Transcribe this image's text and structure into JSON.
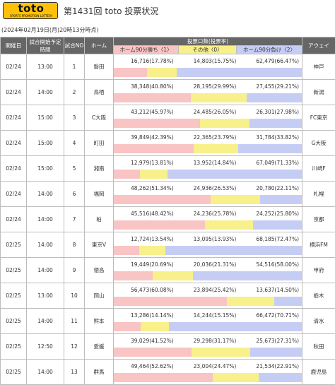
{
  "header": {
    "logo_text": "toto",
    "logo_sub": "SPORTS PROMOTION LOTTERY",
    "title": "第1431回 toto 投票状況"
  },
  "timestamp": "(2024年02月19日(月)20時13分時点)",
  "columns": {
    "date": "開催日",
    "kickoff": "試合開始予定時間",
    "match_no": "試合NO",
    "home": "ホーム",
    "votes": "投票口数(投票率)",
    "win": "ホーム90分勝ち〈1〉",
    "draw": "その他〈0〉",
    "lose": "ホーム90分負け〈2〉",
    "away": "アウェイ"
  },
  "colors": {
    "win": "#f8c4c4",
    "draw": "#f8f08a",
    "lose": "#c6cdf5",
    "header_bg": "#666666",
    "logo": "#ffc107"
  },
  "rows": [
    {
      "date": "02/24",
      "time": "13:00",
      "no": "1",
      "home": "磐田",
      "win_text": "16,716(17.78%)",
      "win": 17.78,
      "draw_text": "14,803(15.75%)",
      "draw": 15.75,
      "lose_text": "62,479(66.47%)",
      "lose": 66.47,
      "away": "神戸"
    },
    {
      "date": "02/24",
      "time": "14:00",
      "no": "2",
      "home": "鳥栖",
      "win_text": "38,348(40.80%)",
      "win": 40.8,
      "draw_text": "28,195(29.99%)",
      "draw": 29.99,
      "lose_text": "27,455(29.21%)",
      "lose": 29.21,
      "away": "新潟"
    },
    {
      "date": "02/24",
      "time": "15:00",
      "no": "3",
      "home": "C大阪",
      "win_text": "43,212(45.97%)",
      "win": 45.97,
      "draw_text": "24,485(26.05%)",
      "draw": 26.05,
      "lose_text": "26,301(27.98%)",
      "lose": 27.98,
      "away": "FC東京"
    },
    {
      "date": "02/24",
      "time": "15:00",
      "no": "4",
      "home": "町田",
      "win_text": "39,849(42.39%)",
      "win": 42.39,
      "draw_text": "22,365(23.79%)",
      "draw": 23.79,
      "lose_text": "31,784(33.82%)",
      "lose": 33.82,
      "away": "G大阪"
    },
    {
      "date": "02/24",
      "time": "15:00",
      "no": "5",
      "home": "湘南",
      "win_text": "12,979(13.81%)",
      "win": 13.81,
      "draw_text": "13,952(14.84%)",
      "draw": 14.84,
      "lose_text": "67,049(71.33%)",
      "lose": 71.33,
      "away": "川崎F"
    },
    {
      "date": "02/24",
      "time": "14:00",
      "no": "6",
      "home": "福岡",
      "win_text": "48,262(51.34%)",
      "win": 51.34,
      "draw_text": "24,936(26.53%)",
      "draw": 26.53,
      "lose_text": "20,780(22.11%)",
      "lose": 22.11,
      "away": "札幌"
    },
    {
      "date": "02/24",
      "time": "14:00",
      "no": "7",
      "home": "柏",
      "win_text": "45,516(48.42%)",
      "win": 48.42,
      "draw_text": "24,236(25.78%)",
      "draw": 25.78,
      "lose_text": "24,252(25.80%)",
      "lose": 25.8,
      "away": "京都"
    },
    {
      "date": "02/25",
      "time": "14:00",
      "no": "8",
      "home": "東京V",
      "win_text": "12,724(13.54%)",
      "win": 13.54,
      "draw_text": "13,095(13.93%)",
      "draw": 13.93,
      "lose_text": "68,185(72.47%)",
      "lose": 72.47,
      "away": "横浜FM"
    },
    {
      "date": "02/25",
      "time": "14:00",
      "no": "9",
      "home": "徳島",
      "win_text": "19,449(20.69%)",
      "win": 20.69,
      "draw_text": "20,036(21.31%)",
      "draw": 21.31,
      "lose_text": "54,516(58.00%)",
      "lose": 58.0,
      "away": "甲府"
    },
    {
      "date": "02/25",
      "time": "13:00",
      "no": "10",
      "home": "岡山",
      "win_text": "56,473(60.08%)",
      "win": 60.08,
      "draw_text": "23,894(25.42%)",
      "draw": 25.42,
      "lose_text": "13,637(14.50%)",
      "lose": 14.5,
      "away": "栃木"
    },
    {
      "date": "02/25",
      "time": "14:00",
      "no": "11",
      "home": "熊本",
      "win_text": "13,286(14.14%)",
      "win": 14.14,
      "draw_text": "14,244(15.15%)",
      "draw": 15.15,
      "lose_text": "66,472(70.71%)",
      "lose": 70.71,
      "away": "清水"
    },
    {
      "date": "02/25",
      "time": "12:50",
      "no": "12",
      "home": "愛媛",
      "win_text": "39,029(41.52%)",
      "win": 41.52,
      "draw_text": "29,298(31.17%)",
      "draw": 31.17,
      "lose_text": "25,673(27.31%)",
      "lose": 27.31,
      "away": "秋田"
    },
    {
      "date": "02/25",
      "time": "14:00",
      "no": "13",
      "home": "群馬",
      "win_text": "49,464(52.62%)",
      "win": 52.62,
      "draw_text": "23,004(24.47%)",
      "draw": 24.47,
      "lose_text": "21,534(22.91%)",
      "lose": 22.91,
      "away": "鹿児島"
    }
  ]
}
